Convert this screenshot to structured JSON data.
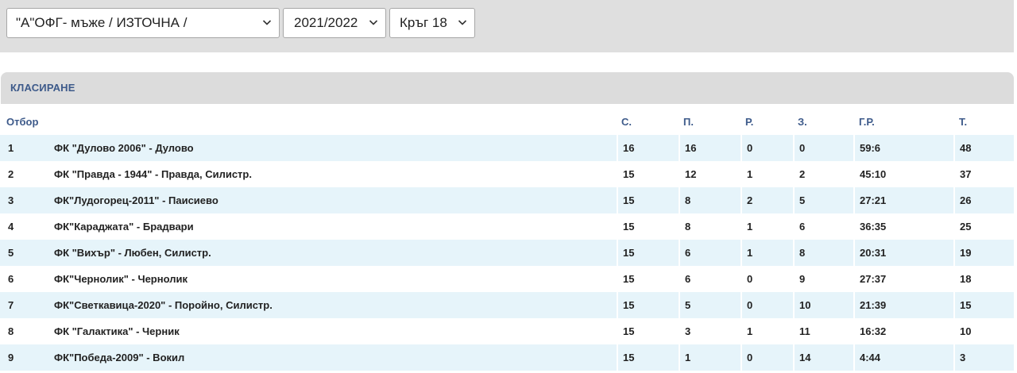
{
  "filters": {
    "league": "\"А\"ОФГ- мъже / ИЗТОЧНА /",
    "season": "2021/2022",
    "round": "Кръг 18"
  },
  "panel": {
    "title": "КЛАСИРАНЕ"
  },
  "table": {
    "headers": {
      "team": "Отбор",
      "played": "С.",
      "won": "П.",
      "drawn": "Р.",
      "lost": "З.",
      "goals": "Г.Р.",
      "points": "Т."
    },
    "rows": [
      {
        "rank": "1",
        "team": "ФК \"Дулово 2006\" - Дулово",
        "played": "16",
        "won": "16",
        "drawn": "0",
        "lost": "0",
        "goals": "59:6",
        "points": "48"
      },
      {
        "rank": "2",
        "team": "ФК \"Правда - 1944\" - Правда, Силистр.",
        "played": "15",
        "won": "12",
        "drawn": "1",
        "lost": "2",
        "goals": "45:10",
        "points": "37"
      },
      {
        "rank": "3",
        "team": "ФК\"Лудогорец-2011\" - Паисиево",
        "played": "15",
        "won": "8",
        "drawn": "2",
        "lost": "5",
        "goals": "27:21",
        "points": "26"
      },
      {
        "rank": "4",
        "team": "ФК\"Караджата\" - Брадвари",
        "played": "15",
        "won": "8",
        "drawn": "1",
        "lost": "6",
        "goals": "36:35",
        "points": "25"
      },
      {
        "rank": "5",
        "team": "ФК \"Вихър\" - Любен, Силистр.",
        "played": "15",
        "won": "6",
        "drawn": "1",
        "lost": "8",
        "goals": "20:31",
        "points": "19"
      },
      {
        "rank": "6",
        "team": "ФК\"Чернолик\" - Чернолик",
        "played": "15",
        "won": "6",
        "drawn": "0",
        "lost": "9",
        "goals": "27:37",
        "points": "18"
      },
      {
        "rank": "7",
        "team": "ФК\"Светкавица-2020\" - Поройно, Силистр.",
        "played": "15",
        "won": "5",
        "drawn": "0",
        "lost": "10",
        "goals": "21:39",
        "points": "15"
      },
      {
        "rank": "8",
        "team": "ФК \"Галактика\" - Черник",
        "played": "15",
        "won": "3",
        "drawn": "1",
        "lost": "11",
        "goals": "16:32",
        "points": "10"
      },
      {
        "rank": "9",
        "team": "ФК\"Победа-2009\" - Вокил",
        "played": "15",
        "won": "1",
        "drawn": "0",
        "lost": "14",
        "goals": "4:44",
        "points": "3"
      }
    ]
  },
  "colors": {
    "header_text": "#3d5a8a",
    "stripe": "#e6f4fa",
    "bar_bg": "#dfdfdf"
  }
}
